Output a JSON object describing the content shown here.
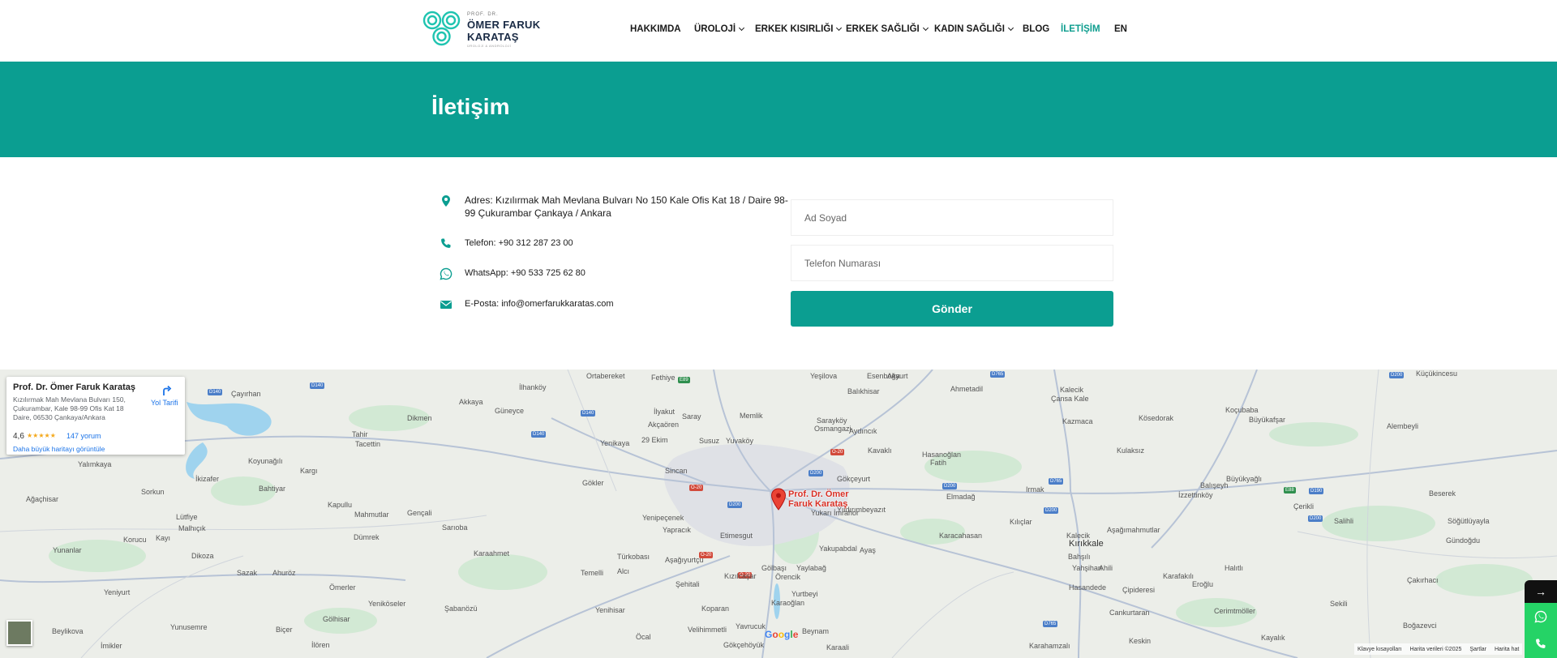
{
  "logo": {
    "small": "PROF. DR.",
    "name_line1": "ÖMER FARUK",
    "name_line2": "KARATAŞ",
    "tagline": "ÜROLOJİ & ANDROLOJİ"
  },
  "nav": {
    "items": [
      {
        "label": "HAKKIMDA"
      },
      {
        "label": "ÜROLOJİ"
      },
      {
        "label": "ERKEK KISIRLIĞI"
      },
      {
        "label": "ERKEK SAĞLIĞI"
      },
      {
        "label": "KADIN SAĞLIĞI"
      },
      {
        "label": "BLOG"
      },
      {
        "label": "İLETİŞİM"
      },
      {
        "label": "EN"
      }
    ],
    "active": "İLETİŞİM",
    "accent": "#0f9e8f"
  },
  "banner": {
    "title": "İletişim",
    "bg": "#0b9e91"
  },
  "contact": {
    "address": "Adres: Kızılırmak Mah Mevlana Bulvarı No 150 Kale Ofis Kat 18 / Daire 98-99 Çukurambar Çankaya / Ankara",
    "phone": "Telefon: +90 312 287 23 00",
    "whatsapp": "WhatsApp: +90 533 725 62 80",
    "email": "E-Posta: info@omerfarukkaratas.com",
    "icons": [
      "location-pin-icon",
      "phone-icon",
      "whatsapp-icon",
      "envelope-icon"
    ]
  },
  "form": {
    "name_placeholder": "Ad Soyad",
    "phone_placeholder": "Telefon Numarası",
    "submit_label": "Gönder"
  },
  "map": {
    "card": {
      "title": "Prof. Dr. Ömer Faruk Karataş",
      "address": "Kızılırmak Mah Mevlana Bulvarı 150, Çukurambar, Kale 98-99 Ofis Kat 18 Daire, 06530 Çankaya/Ankara",
      "rating": "4,6",
      "stars": "★★★★★",
      "reviews": "147 yorum",
      "bigger_map": "Daha büyük haritayı görüntüle",
      "directions": "Yol Tarifi"
    },
    "pin_label_line1": "Prof. Dr. Ömer",
    "pin_label_line2": "Faruk Karataş",
    "places": [
      "Ortabereket",
      "Fethiye",
      "Yeşilova",
      "Esenboğa",
      "Akyurt",
      "Ahmetadil",
      "Küçükincesu",
      "Çayırhan",
      "İlhanköy",
      "Akkaya",
      "Güneyce",
      "Memlik",
      "Saray",
      "Balıkhisar",
      "Kalecik",
      "Çansa Kale",
      "Dikmen",
      "Tahir",
      "Tacettin",
      "İlyakut",
      "Akçaören",
      "Yenikaya",
      "29 Ekim",
      "Susuz",
      "Yuvaköy",
      "Sarayköy",
      "Osmangazi",
      "Aydıncık",
      "Kazmaca",
      "Kösedorak",
      "Koçubaba",
      "Büyükafşar",
      "Alembeyli",
      "Yalımkaya",
      "Koyunağılı",
      "Kargı",
      "Sincan",
      "Kavaklı",
      "Hasanoğlan",
      "Fatih",
      "Kulaksız",
      "İkizafer",
      "Bahtiyar",
      "Gökler",
      "Gökçeyurt",
      "Irmak",
      "İzzettinköy",
      "Büyükyağlı",
      "Ağaçhisar",
      "Sorkun",
      "Kapullu",
      "Mahmutlar",
      "Gençali",
      "Yenipeçenek",
      "Yukarı İmrahor",
      "Yıldırımbeyazıt",
      "Elmadağ",
      "Balışeyh",
      "Çerikli",
      "Beserek",
      "Salihli",
      "Lütfiye",
      "Malhıçık",
      "Sarıoba",
      "Yapracık",
      "Kılıçlar",
      "Kırıkkale",
      "Söğütlüyayla",
      "Korucu",
      "Kayı",
      "Dümrek",
      "Etimesgut",
      "Karacahasan",
      "Aşağımahmutlar",
      "Gündoğdu",
      "Yunanlar",
      "Ayaş",
      "Yakupabdal",
      "Bahşılı",
      "Dikoza",
      "Karaahmet",
      "Türkobası",
      "Aşağıyurtçu",
      "Temelli",
      "Alcı",
      "Gölbaşı",
      "Yaylabağ",
      "Örencik",
      "Yahşihan",
      "Ahili",
      "Kalecik",
      "Karafakılı",
      "Halıtlı",
      "Çakırhacı",
      "Yeniyurt",
      "Ahuröz",
      "Sazak",
      "Şehitali",
      "Kızılcaşar",
      "Yurtbeyi",
      "Hasandede",
      "Eroğlu",
      "Sekili",
      "Ömerler",
      "Yeniköseler",
      "Şabanözü",
      "Yenihisar",
      "Koparan",
      "Karaoğlan",
      "Çipideresi",
      "Cerimtmöller",
      "Yunusemre",
      "Biçer",
      "Gölhisar",
      "Velihimmetli",
      "Yavrucuk",
      "Beynam",
      "Cankurtaran",
      "Boğazevci",
      "Beylikova",
      "İmikler",
      "İlören",
      "Öcal",
      "Gökçehöyük",
      "Karaali",
      "Keskin",
      "Karahamzalı",
      "Kayalık"
    ],
    "footer": [
      "Klavye kısayolları",
      "Harita verileri ©2025",
      "Şartlar",
      "Harita hat"
    ],
    "google": "Google"
  },
  "floating": {
    "arrow": "→",
    "icons": [
      "whatsapp-icon",
      "phone-icon"
    ]
  }
}
